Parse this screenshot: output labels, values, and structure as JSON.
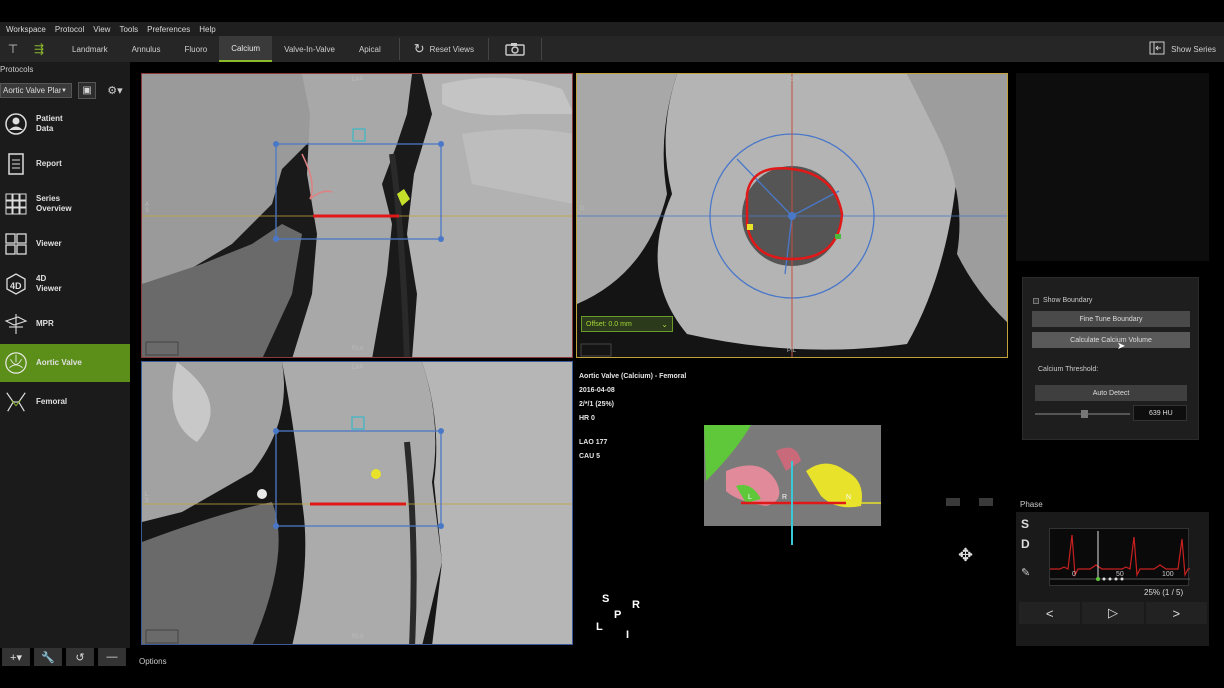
{
  "menu": [
    "Workspace",
    "Protocol",
    "View",
    "Tools",
    "Preferences",
    "Help"
  ],
  "toolbar": {
    "tabs": [
      "Landmark",
      "Annulus",
      "Fluoro",
      "Calcium",
      "Valve-In-Valve",
      "Apical"
    ],
    "active_tab": "Calcium",
    "reset_label": "Reset Views",
    "show_series_label": "Show Series"
  },
  "sidebar": {
    "protocols_label": "Protocols",
    "plan_select": "Aortic Valve Plan",
    "items": [
      {
        "label": "Patient\nData",
        "icon": "person-icon"
      },
      {
        "label": "Report",
        "icon": "report-icon"
      },
      {
        "label": "Series\nOverview",
        "icon": "grid-icon"
      },
      {
        "label": "Viewer",
        "icon": "viewer-icon"
      },
      {
        "label": "4D\nViewer",
        "icon": "cube-4d-icon"
      },
      {
        "label": "MPR",
        "icon": "mpr-icon"
      },
      {
        "label": "Aortic Valve",
        "icon": "aortic-valve-icon"
      },
      {
        "label": "Femoral",
        "icon": "femoral-icon"
      }
    ],
    "active": "Aortic Valve"
  },
  "options_label": "Options",
  "viewports": {
    "tl": {
      "top": "LAP",
      "bottom": "RLA",
      "left": "A\nS"
    },
    "tr": {
      "top": "ASR",
      "bottom": "PIL",
      "left": "D",
      "offset": "Offset: 0.0 mm"
    },
    "bl": {
      "top": "LAP",
      "bottom": "RLA",
      "left": "L\nS"
    }
  },
  "info": {
    "title": "Aortic Valve (Calcium) - Femoral",
    "date": "2016-04-08",
    "phase": "2/*/1 (25%)",
    "hr": "HR 0",
    "lao": "LAO 177",
    "cau": "CAU 5"
  },
  "orientation_cube": {
    "s": "S",
    "r": "R",
    "p": "P",
    "l": "L",
    "i": "I"
  },
  "calcium": {
    "show_boundary": "Show Boundary",
    "fine_tune": "Fine Tune Boundary",
    "calculate": "Calculate Calcium Volume",
    "threshold_label": "Calcium Threshold:",
    "auto_detect": "Auto Detect",
    "threshold_value": "639 HU"
  },
  "phase": {
    "label": "Phase",
    "s": "S",
    "d": "D",
    "axis": [
      "0",
      "50",
      "100"
    ],
    "percent": "25% (1 / 5)",
    "prev": "<",
    "play": "▷",
    "next": ">"
  },
  "colors": {
    "accent": "#5c8f1a",
    "calcium": "#e8e22a",
    "annulus": "#e01818",
    "guide": "#4a78c8"
  }
}
